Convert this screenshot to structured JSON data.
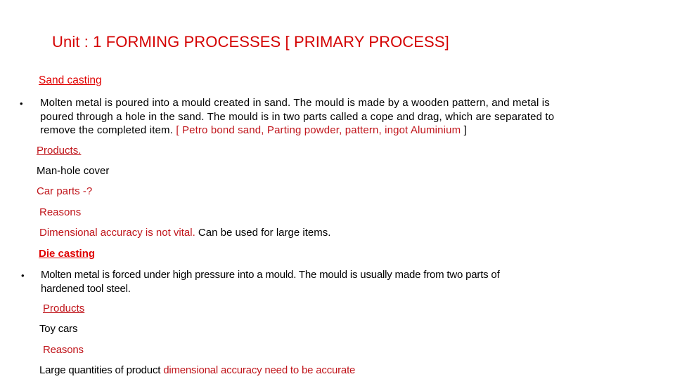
{
  "title": "Unit : 1 FORMING  PROCESSES [ PRIMARY PROCESS]",
  "sand_casting": {
    "heading": "Sand casting",
    "bullet": "•",
    "description_lines": [
      "Molten metal is poured into a mould created in sand. The mould is made by a wooden pattern, and metal is",
      "poured through a hole in the sand. The mould is in two parts called a cope and drag, which are separated to",
      "remove the completed item. "
    ],
    "materials": "[ Petro bond sand, Parting powder,  pattern,  ingot Aluminium ",
    "materials_close": "]",
    "products_heading": "Products.",
    "products": [
      "Man-hole cover"
    ],
    "products_question": "Car parts -?",
    "reasons_heading": "Reasons",
    "reasons_red": "Dimensional accuracy is not vital.",
    "reasons_black": " Can be used for large items."
  },
  "die_casting": {
    "heading": "Die casting",
    "bullet": "•",
    "description_lines": [
      "Molten metal is forced under high pressure into a mould. The mould is usually made from two parts of",
      "hardened tool steel."
    ],
    "products_heading": "Products",
    "products": [
      "Toy cars"
    ],
    "reasons_heading": "Reasons",
    "reasons_black": "Large quantities of product ",
    "reasons_red": "dimensional accuracy  need to be accurate"
  },
  "colors": {
    "title": "#d40000",
    "heading": "#e00000",
    "accent_red": "#c0151b",
    "text": "#000000"
  }
}
